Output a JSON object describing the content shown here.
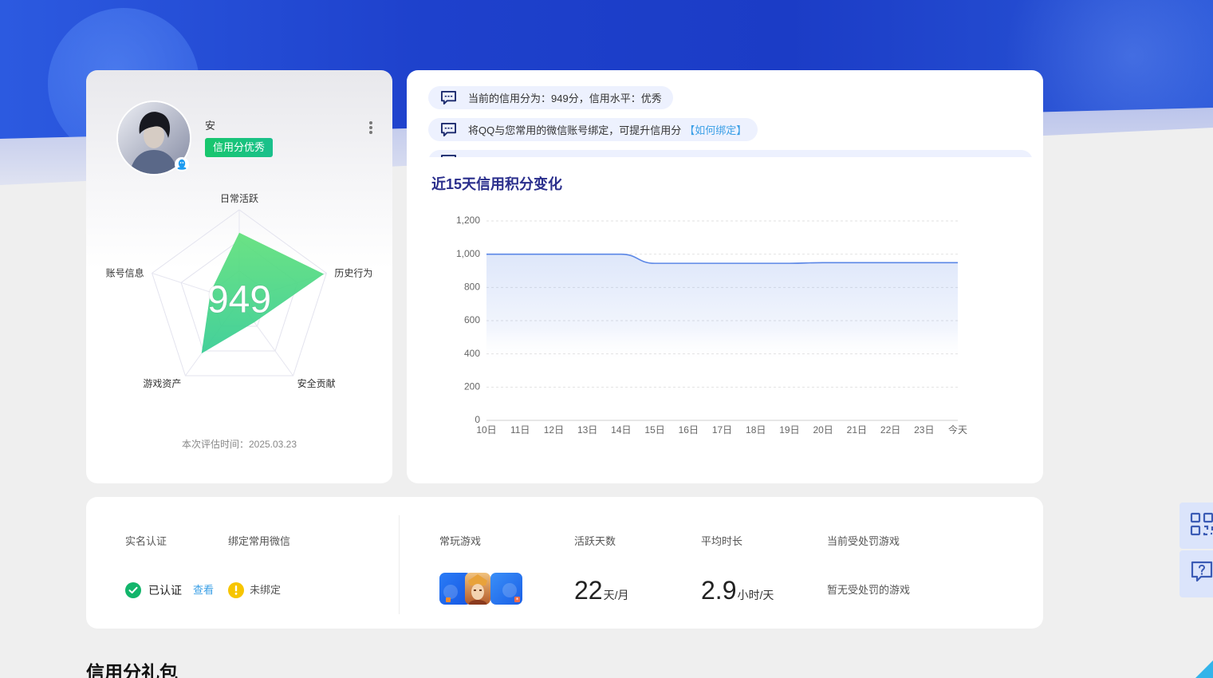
{
  "profile": {
    "name": "安",
    "badge": "信用分优秀",
    "eval_time": "本次评估时间：2025.03.23"
  },
  "messages": [
    {
      "text": "当前的信用分为：949分，信用水平：优秀"
    },
    {
      "text": "将QQ与您常用的微信账号绑定，可提升信用分",
      "link": "【如何绑定】"
    }
  ],
  "stats": {
    "realname": {
      "label": "实名认证",
      "status": "已认证",
      "link": "查看"
    },
    "wechat": {
      "label": "绑定常用微信",
      "status": "未绑定"
    },
    "games": {
      "label": "常玩游戏",
      "icons": [
        "game-icon",
        "game-hero-icon",
        "game-icon"
      ]
    },
    "active_days": {
      "label": "活跃天数",
      "value": "22",
      "unit": "天/月"
    },
    "avg_time": {
      "label": "平均时长",
      "value": "2.9",
      "unit": "小时/天"
    },
    "punished": {
      "label": "当前受处罚游戏",
      "value": "暂无受处罚的游戏"
    }
  },
  "section_title": "信用分礼包",
  "sidebar": {
    "buttons": [
      {
        "icon": "qr-code-icon"
      },
      {
        "icon": "help-icon"
      }
    ]
  },
  "colors": {
    "brand_blue": "#1f42cc",
    "score_green": "#4cdc88",
    "badge_green": "#16c46e",
    "link_blue": "#3a9fe6",
    "verified_green": "#12b56b",
    "warning_yellow": "#f7c500",
    "chart_line": "#5b87e6",
    "title_indigo": "#2a2e8c"
  },
  "chart_data": [
    {
      "type": "radar",
      "categories": [
        "日常活跃",
        "历史行为",
        "安全贡献",
        "游戏资产",
        "账号信息"
      ],
      "values": [
        0.75,
        0.97,
        0.28,
        0.7,
        0.33
      ],
      "max": 1,
      "center_label": "949"
    },
    {
      "type": "area",
      "title": "近15天信用积分变化",
      "categories": [
        "10日",
        "11日",
        "12日",
        "13日",
        "14日",
        "15日",
        "16日",
        "17日",
        "18日",
        "19日",
        "20日",
        "21日",
        "22日",
        "23日",
        "今天"
      ],
      "values": [
        1000,
        1000,
        1000,
        1000,
        1000,
        945,
        945,
        945,
        945,
        945,
        949,
        949,
        949,
        949,
        949
      ],
      "ylim": [
        0,
        1200
      ],
      "yticks": [
        0,
        200,
        400,
        600,
        800,
        1000,
        1200
      ],
      "ytick_labels": [
        "0",
        "200",
        "400",
        "600",
        "800",
        "1,000",
        "1,200"
      ],
      "grid": true,
      "legend": "none"
    }
  ]
}
